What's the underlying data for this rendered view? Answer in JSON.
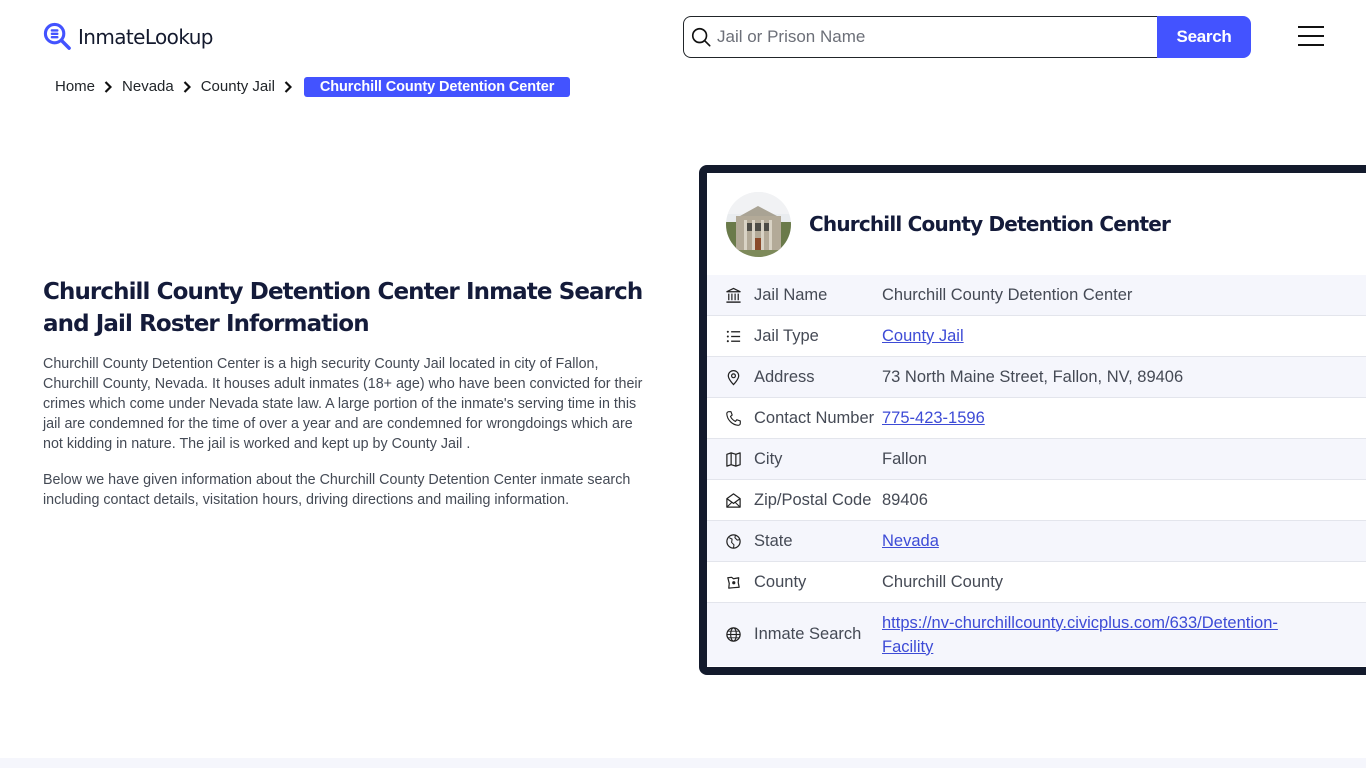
{
  "header": {
    "logo_text": "InmateLookup",
    "search": {
      "placeholder": "Jail or Prison Name",
      "value": "",
      "button_label": "Search"
    },
    "menu_icon": "hamburger-menu-icon"
  },
  "breadcrumb": {
    "items": [
      "Home",
      "Nevada",
      "County Jail"
    ],
    "current": "Churchill County Detention Center"
  },
  "intro": {
    "title": "Churchill County Detention Center Inmate Search and Jail Roster Information",
    "paragraphs": [
      "Churchill County Detention Center is a high security County Jail located in city of Fallon, Churchill County, Nevada. It houses adult inmates (18+ age) who have been convicted for their crimes which come under Nevada state law. A large portion of the inmate's serving time in this jail are condemned for the time of over a year and are condemned for wrongdoings which are not kidding in nature. The jail is worked and kept up by County Jail .",
      "Below we have given information about the Churchill County Detention Center inmate search including contact details, visitation hours, driving directions and mailing information."
    ]
  },
  "card": {
    "title": "Churchill County Detention Center",
    "rows": [
      {
        "icon": "bank-icon",
        "label": "Jail Name",
        "value": "Churchill County Detention Center",
        "link": false
      },
      {
        "icon": "list-icon",
        "label": "Jail Type",
        "value": "County Jail",
        "link": true
      },
      {
        "icon": "map-pin-icon",
        "label": "Address",
        "value": "73 North Maine Street, Fallon, NV, 89406",
        "link": false
      },
      {
        "icon": "phone-icon",
        "label": "Contact Number",
        "value": "775-423-1596",
        "link": true
      },
      {
        "icon": "map-icon",
        "label": "City",
        "value": "Fallon",
        "link": false
      },
      {
        "icon": "mail-open-icon",
        "label": "Zip/Postal Code",
        "value": "89406",
        "link": false
      },
      {
        "icon": "globe-region-icon",
        "label": "State",
        "value": "Nevada",
        "link": true
      },
      {
        "icon": "county-map-icon",
        "label": "County",
        "value": "Churchill County",
        "link": false
      },
      {
        "icon": "globe-icon",
        "label": "Inmate Search",
        "value": "https://nv-churchillcounty.civicplus.com/633/Detention-Facility",
        "link": true
      }
    ]
  },
  "colors": {
    "accent": "#4353ff",
    "card_border": "#131a2c",
    "link": "#3d4bd6",
    "row_alt": "#f5f6fc",
    "heading": "#141b3a"
  }
}
